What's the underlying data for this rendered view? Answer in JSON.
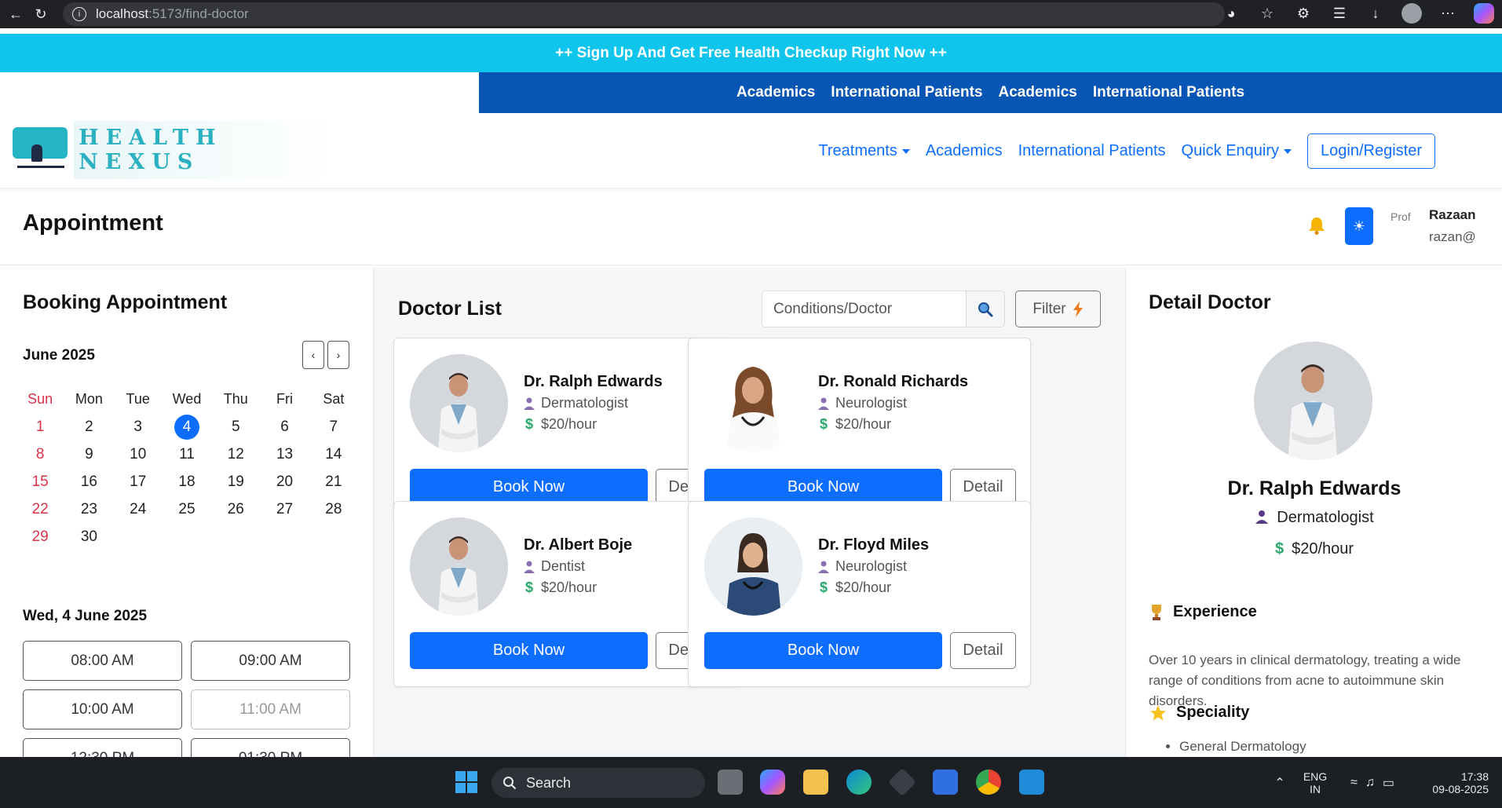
{
  "browser": {
    "url_host": "localhost",
    "url_path": ":5173/find-doctor"
  },
  "promo": {
    "text": "++ Sign Up And Get Free Health Checkup Right Now ++"
  },
  "topbar": {
    "links": [
      "Academics",
      "International Patients",
      "Academics",
      "International Patients"
    ]
  },
  "nav": {
    "logo_text": "HEALTH NEXUS",
    "links": {
      "treatments": "Treatments",
      "academics": "Academics",
      "international": "International Patients",
      "enquiry": "Quick Enquiry"
    },
    "login": "Login/Register"
  },
  "header": {
    "title": "Appointment",
    "profile_alt": "Prof",
    "user_name": "Razaan",
    "user_email": "razan@"
  },
  "booking": {
    "title": "Booking Appointment",
    "month": "June 2025",
    "prev": "‹",
    "next": "›",
    "weekdays": [
      "Sun",
      "Mon",
      "Tue",
      "Wed",
      "Thu",
      "Fri",
      "Sat"
    ],
    "weeks": [
      [
        "1",
        "2",
        "3",
        "4",
        "5",
        "6",
        "7"
      ],
      [
        "8",
        "9",
        "10",
        "11",
        "12",
        "13",
        "14"
      ],
      [
        "15",
        "16",
        "17",
        "18",
        "19",
        "20",
        "21"
      ],
      [
        "22",
        "23",
        "24",
        "25",
        "26",
        "27",
        "28"
      ],
      [
        "29",
        "30",
        "",
        "",
        "",
        "",
        ""
      ]
    ],
    "selected_day": "4",
    "selected_date": "Wed, 4 June 2025",
    "slots": [
      {
        "time": "08:00 AM",
        "available": true
      },
      {
        "time": "09:00 AM",
        "available": true
      },
      {
        "time": "10:00 AM",
        "available": true
      },
      {
        "time": "11:00 AM",
        "available": false
      },
      {
        "time": "12:30 PM",
        "available": true
      },
      {
        "time": "01:30 PM",
        "available": true
      }
    ]
  },
  "doctors": {
    "title": "Doctor List",
    "search_placeholder": "Conditions/Doctor",
    "filter": "Filter",
    "book_label": "Book Now",
    "detail_label": "Detail",
    "list": [
      {
        "name": "Dr. Ralph Edwards",
        "specialty": "Dermatologist",
        "rate": "$20/hour"
      },
      {
        "name": "Dr. Ronald Richards",
        "specialty": "Neurologist",
        "rate": "$20/hour"
      },
      {
        "name": "Dr. Albert Boje",
        "specialty": "Dentist",
        "rate": "$20/hour"
      },
      {
        "name": "Dr. Floyd Miles",
        "specialty": "Neurologist",
        "rate": "$20/hour"
      }
    ]
  },
  "detail": {
    "title": "Detail Doctor",
    "name": "Dr. Ralph Edwards",
    "specialty": "Dermatologist",
    "rate": "$20/hour",
    "experience_title": "Experience",
    "experience_text": "Over 10 years in clinical dermatology, treating a wide range of conditions from acne to autoimmune skin disorders.",
    "speciality_title": "Speciality",
    "speciality_items": [
      "General Dermatology"
    ]
  },
  "taskbar": {
    "search": "Search",
    "lang1": "ENG",
    "lang2": "IN",
    "time": "17:38",
    "date": "09-08-2025"
  },
  "colors": {
    "primary": "#0d6efd",
    "promo": "#10c5ec",
    "topbar": "#0755b4",
    "sunday": "#d9334b"
  }
}
